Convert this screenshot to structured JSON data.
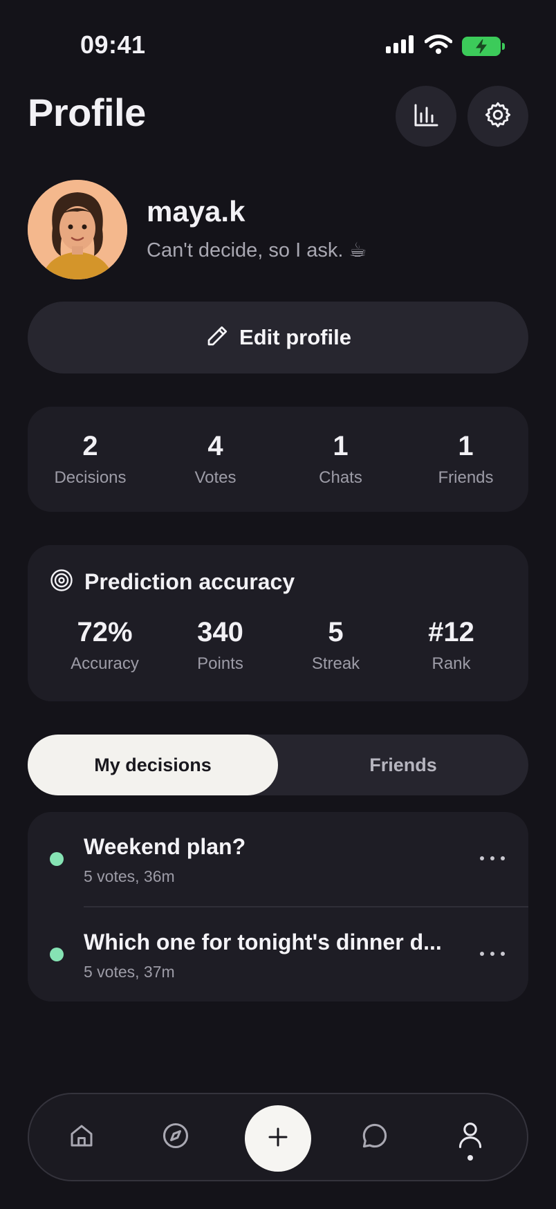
{
  "status_bar": {
    "time": "09:41"
  },
  "header": {
    "title": "Profile",
    "stats_icon": "bar-chart-icon",
    "settings_icon": "gear-icon"
  },
  "profile": {
    "username": "maya.k",
    "bio": "Can't decide, so I ask. ☕",
    "edit_label": "Edit profile"
  },
  "stats": [
    {
      "value": "2",
      "label": "Decisions"
    },
    {
      "value": "4",
      "label": "Votes"
    },
    {
      "value": "1",
      "label": "Chats"
    },
    {
      "value": "1",
      "label": "Friends"
    }
  ],
  "prediction": {
    "title": "Prediction accuracy",
    "items": [
      {
        "value": "72%",
        "label": "Accuracy"
      },
      {
        "value": "340",
        "label": "Points"
      },
      {
        "value": "5",
        "label": "Streak"
      },
      {
        "value": "#12",
        "label": "Rank"
      }
    ]
  },
  "tabs": [
    {
      "label": "My decisions",
      "active": true
    },
    {
      "label": "Friends",
      "active": false
    }
  ],
  "decisions": [
    {
      "title": "Weekend plan?",
      "meta": "5 votes, 36m"
    },
    {
      "title": "Which one for tonight's dinner d...",
      "meta": "5 votes, 37m"
    }
  ],
  "nav": {
    "items": [
      "home-icon",
      "compass-icon",
      "plus-icon",
      "chat-bubble-icon",
      "person-icon"
    ],
    "active": "person-icon"
  },
  "colors": {
    "background": "#141319",
    "card": "#1e1d25",
    "accent_dot": "#86e3b4",
    "battery": "#3ccb5a"
  }
}
